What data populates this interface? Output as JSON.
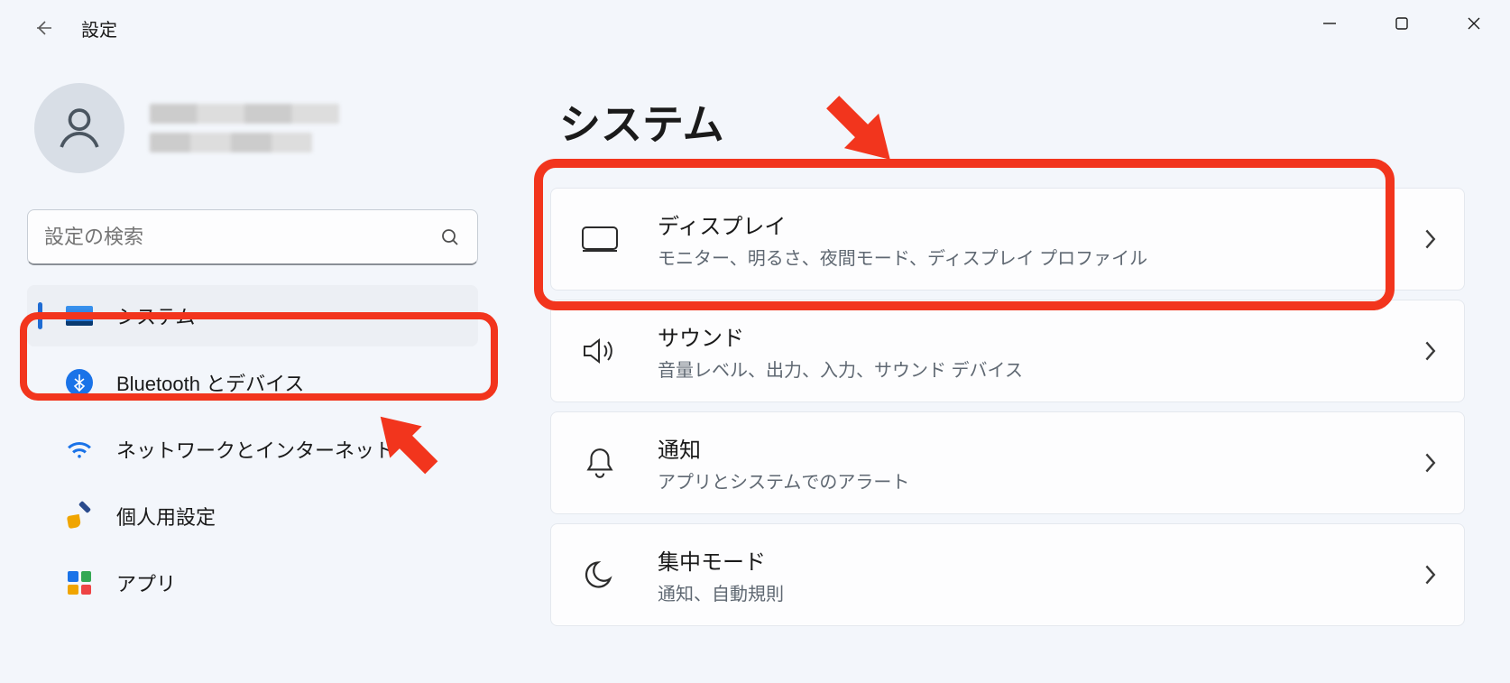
{
  "window": {
    "title": "設定"
  },
  "search": {
    "placeholder": "設定の検索"
  },
  "nav": {
    "items": [
      {
        "label": "システム",
        "selected": true
      },
      {
        "label": "Bluetooth とデバイス",
        "selected": false
      },
      {
        "label": "ネットワークとインターネット",
        "selected": false
      },
      {
        "label": "個人用設定",
        "selected": false
      },
      {
        "label": "アプリ",
        "selected": false
      }
    ]
  },
  "page": {
    "title": "システム"
  },
  "cards": [
    {
      "title": "ディスプレイ",
      "subtitle": "モニター、明るさ、夜間モード、ディスプレイ プロファイル"
    },
    {
      "title": "サウンド",
      "subtitle": "音量レベル、出力、入力、サウンド デバイス"
    },
    {
      "title": "通知",
      "subtitle": "アプリとシステムでのアラート"
    },
    {
      "title": "集中モード",
      "subtitle": "通知、自動規則"
    }
  ]
}
